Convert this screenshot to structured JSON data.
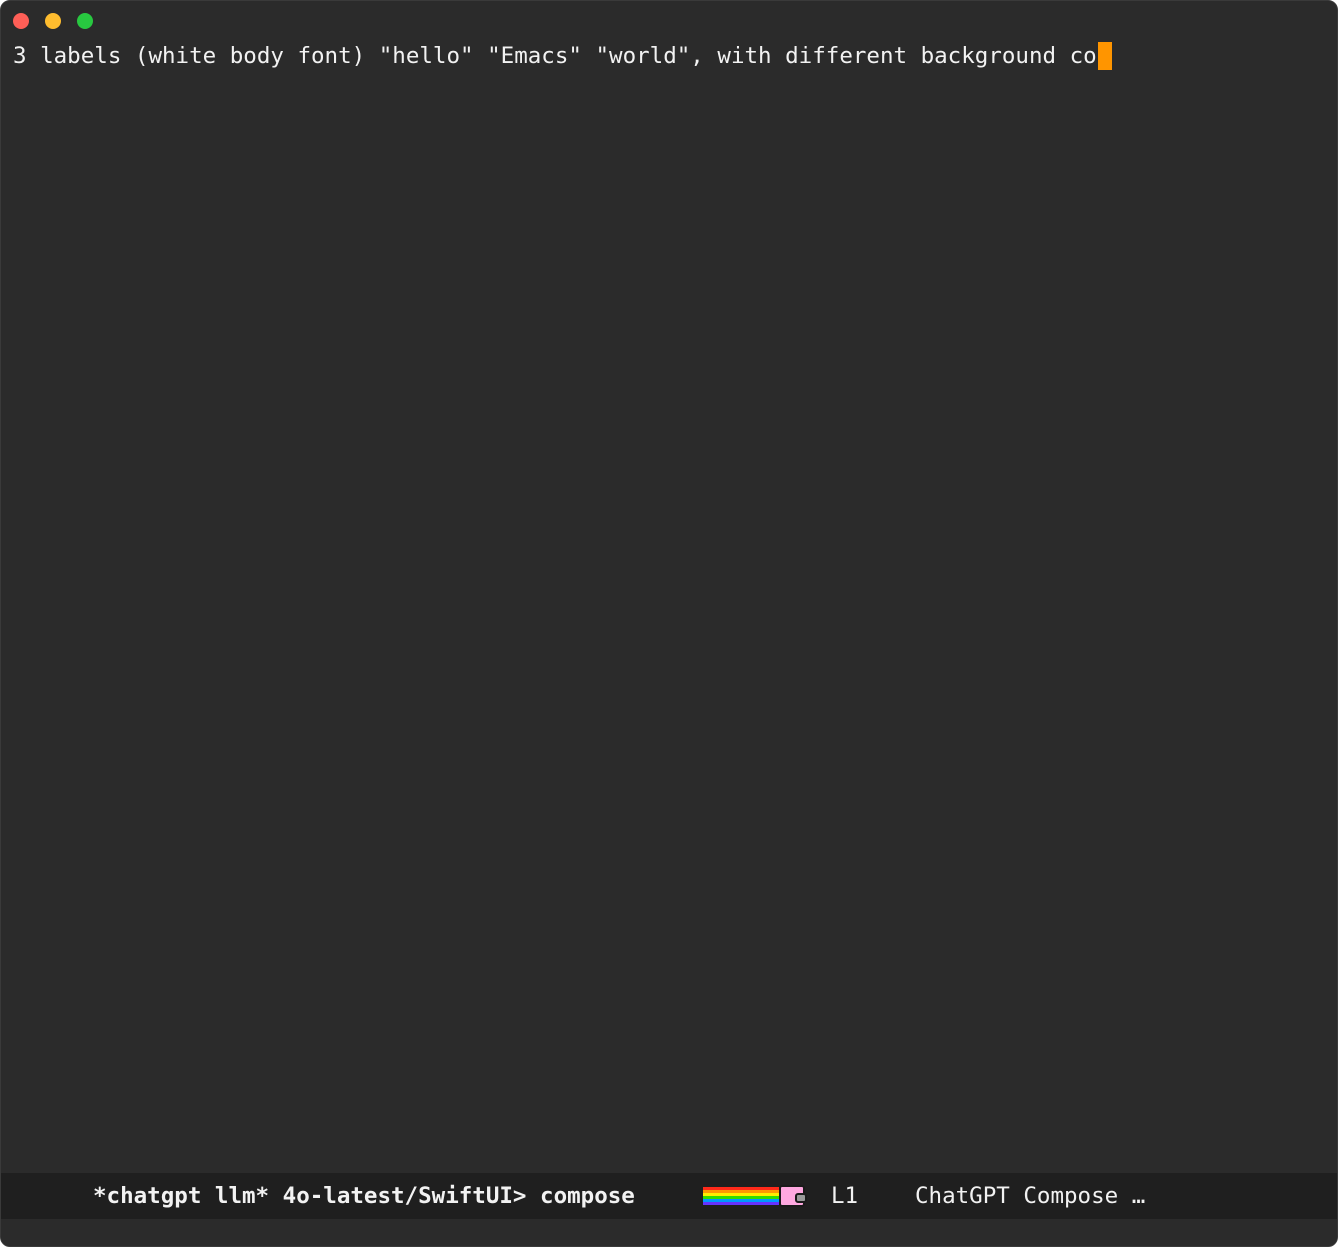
{
  "window": {
    "controls": {
      "close_color": "#fe5f57",
      "minimize_color": "#febc2e",
      "zoom_color": "#28c840"
    }
  },
  "editor": {
    "line_1": "3 labels (white body font) \"hello\" \"Emacs\" \"world\", with different background co",
    "cursor_color": "#ff9500",
    "background_color": "#2b2b2b"
  },
  "modeline": {
    "buffer_info": "*chatgpt llm* 4o-latest/SwiftUI> compose",
    "progress_indicator": "nyan-cat-icon",
    "line_position": "L1",
    "mode": "ChatGPT Compose …"
  }
}
